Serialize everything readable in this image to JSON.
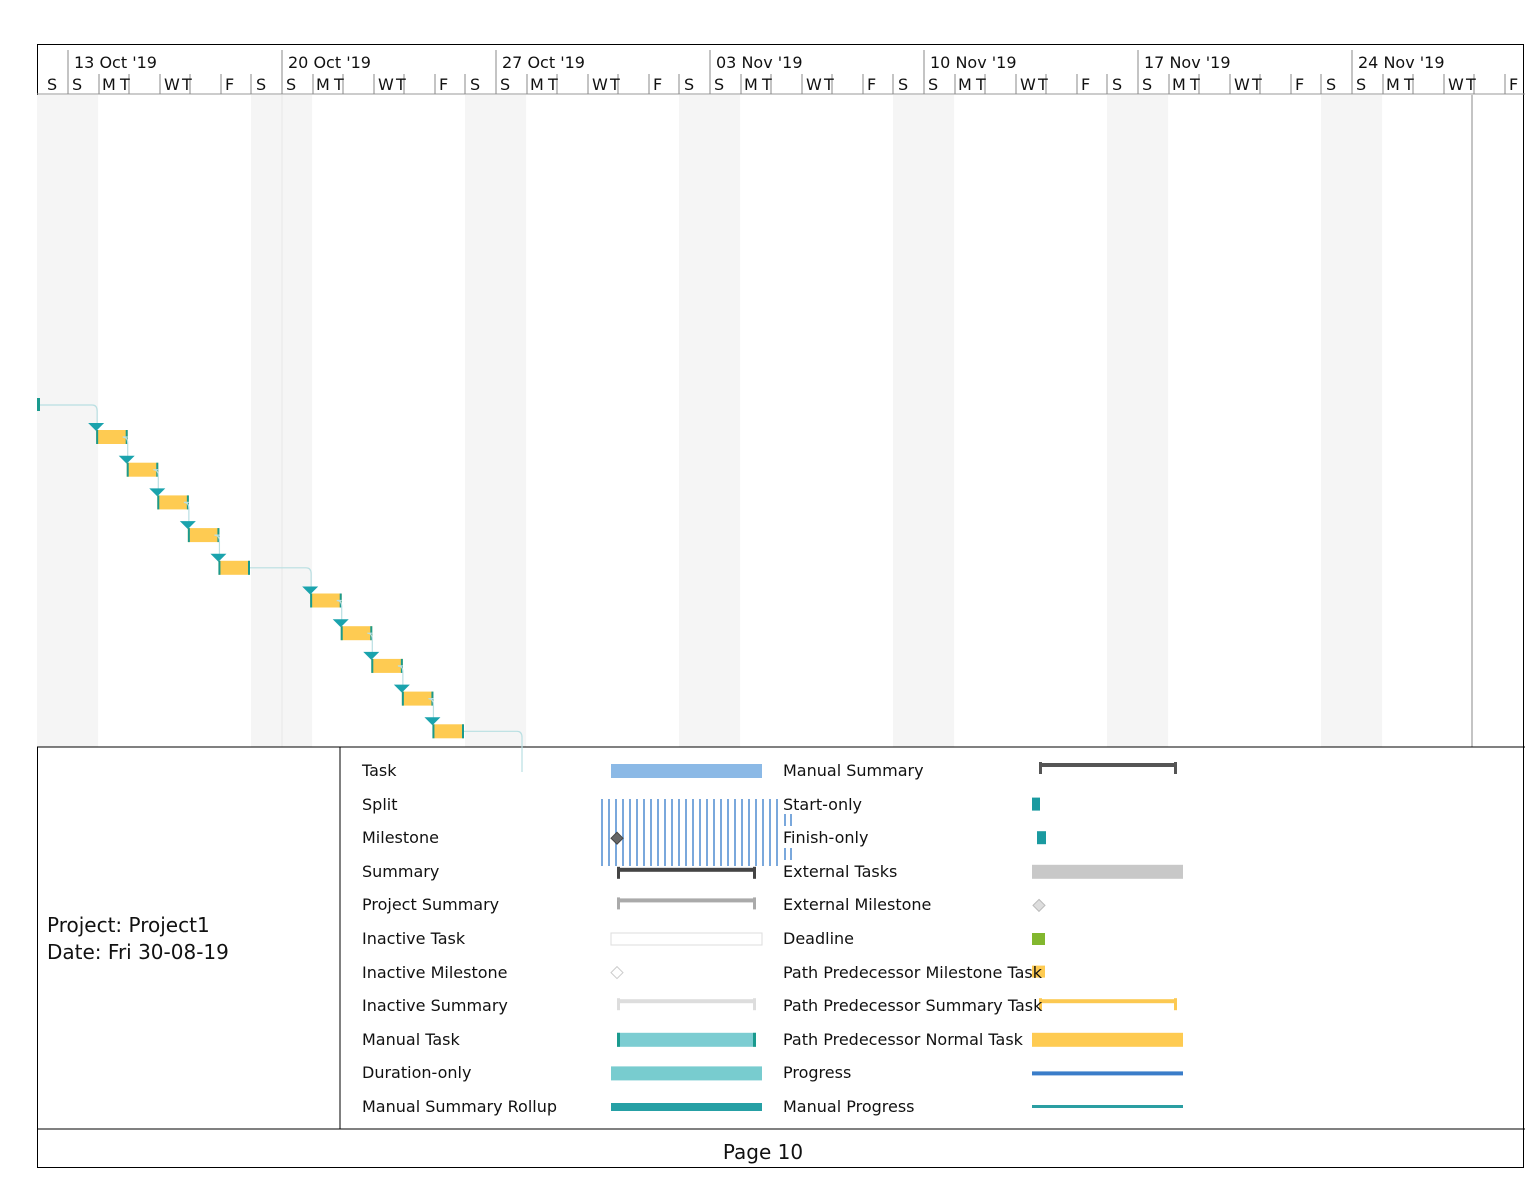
{
  "timescale": {
    "weeks": [
      "13 Oct '19",
      "20 Oct '19",
      "27 Oct '19",
      "03 Nov '19",
      "10 Nov '19",
      "17 Nov '19",
      "24 Nov '19"
    ],
    "leading_day": "S",
    "days": [
      "S",
      "M",
      "T",
      "W",
      "T",
      "F",
      "S"
    ]
  },
  "colors": {
    "task_bar": "#fecb52",
    "task_bar_edge": "#1a9a8e",
    "arrow": "#1aa3ad",
    "link_line": "#b9dfe2",
    "nonworking": "#f5f5f5"
  },
  "chart_data": {
    "type": "bar",
    "subtype": "gantt",
    "x_axis": "date",
    "xlim": [
      "2019-10-12",
      "2019-11-29"
    ],
    "start_only_marker": "2019-10-12",
    "tasks": [
      {
        "start": "2019-10-14",
        "finish": "2019-10-14"
      },
      {
        "start": "2019-10-15",
        "finish": "2019-10-15"
      },
      {
        "start": "2019-10-16",
        "finish": "2019-10-16"
      },
      {
        "start": "2019-10-17",
        "finish": "2019-10-17"
      },
      {
        "start": "2019-10-18",
        "finish": "2019-10-18"
      },
      {
        "start": "2019-10-21",
        "finish": "2019-10-21"
      },
      {
        "start": "2019-10-22",
        "finish": "2019-10-22"
      },
      {
        "start": "2019-10-23",
        "finish": "2019-10-23"
      },
      {
        "start": "2019-10-24",
        "finish": "2019-10-24"
      },
      {
        "start": "2019-10-25",
        "finish": "2019-10-25"
      }
    ],
    "links": "finish-to-start, sequential"
  },
  "project": {
    "name_line": "Project: Project1",
    "date_line": "Date: Fri 30-08-19"
  },
  "legend": {
    "left": [
      "Task",
      "Split",
      "Milestone",
      "Summary",
      "Project Summary",
      "Inactive Task",
      "Inactive Milestone",
      "Inactive Summary",
      "Manual Task",
      "Duration-only",
      "Manual Summary Rollup"
    ],
    "right": [
      "Manual Summary",
      "Start-only",
      "Finish-only",
      "External Tasks",
      "External Milestone",
      "Deadline",
      "Path Predecessor Milestone Task",
      "Path Predecessor Summary Task",
      "Path Predecessor Normal Task",
      "Progress",
      "Manual Progress"
    ]
  },
  "footer": {
    "page": "Page 10"
  }
}
